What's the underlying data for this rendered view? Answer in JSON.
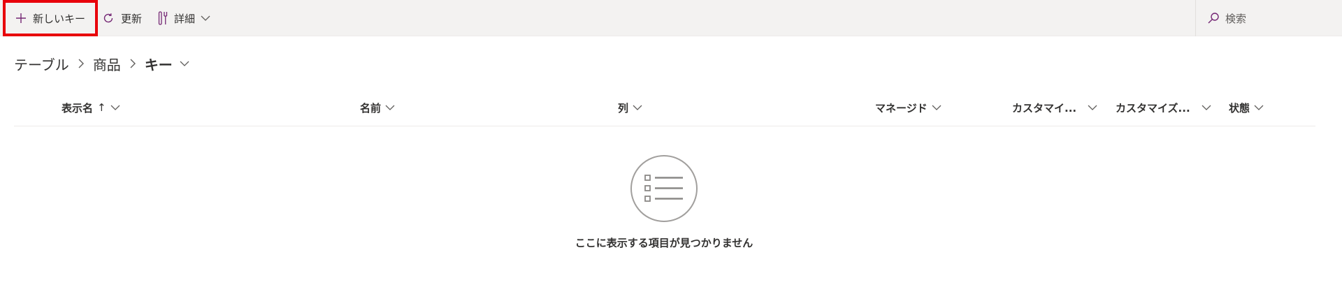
{
  "toolbar": {
    "new_key": "新しいキー",
    "refresh": "更新",
    "more": "詳細",
    "search_placeholder": "検索",
    "accent_color": "#742774",
    "highlight_color": "#e8000b"
  },
  "breadcrumb": {
    "items": [
      "テーブル",
      "商品"
    ],
    "current": "キー"
  },
  "table": {
    "columns": [
      "表示名",
      "名前",
      "列",
      "マネージド",
      "カスタマイ...",
      "カスタマイズ...",
      "状態"
    ],
    "sort_indicator": "↑"
  },
  "empty_state": {
    "message": "ここに表示する項目が見つかりません",
    "icon": "list-icon"
  }
}
